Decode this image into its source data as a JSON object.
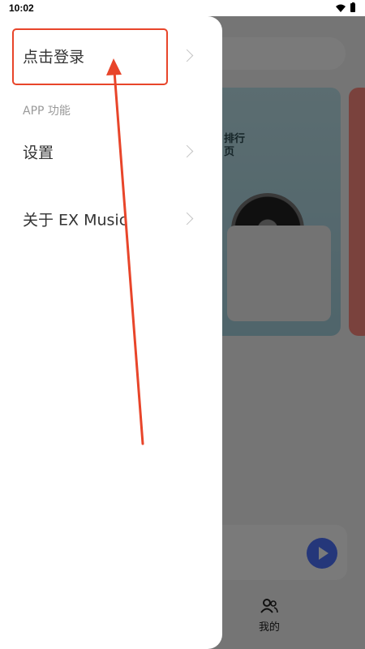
{
  "status_bar": {
    "time": "10:02"
  },
  "drawer": {
    "login_label": "点击登录",
    "section_title": "APP 功能",
    "items": [
      {
        "label": "设置"
      },
      {
        "label": "关于 EX Music"
      }
    ]
  },
  "background": {
    "banner_title_line1": "排行",
    "banner_title_line2": "页",
    "nav_mine_label": "我的"
  },
  "annotation": {
    "color": "#e8452a"
  }
}
